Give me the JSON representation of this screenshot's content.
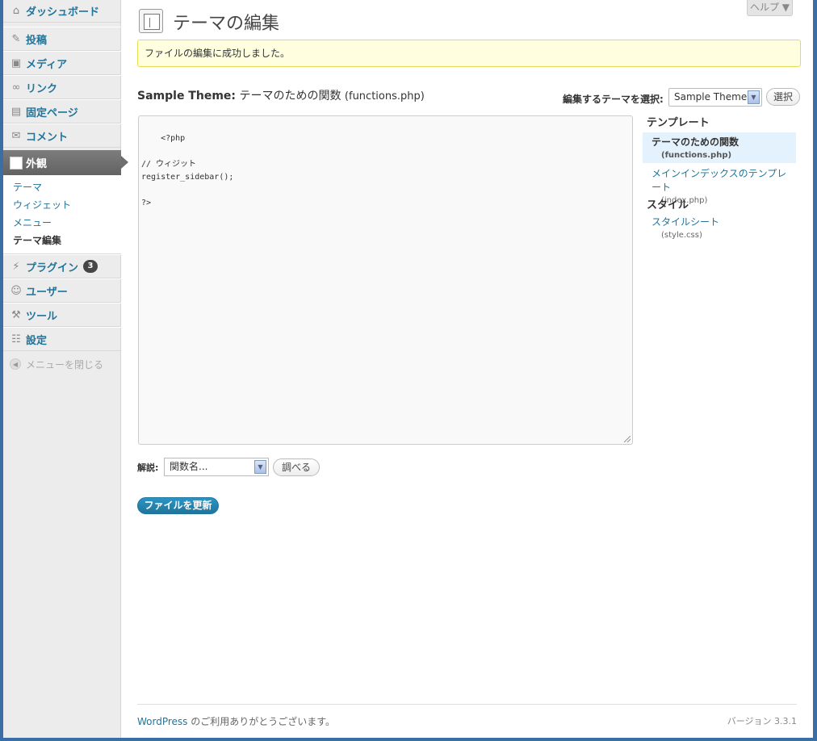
{
  "sidebar": {
    "items": [
      {
        "label": "ダッシュボード",
        "icon": "home-icon"
      },
      {
        "label": "投稿",
        "icon": "pin-icon"
      },
      {
        "label": "メディア",
        "icon": "media-icon"
      },
      {
        "label": "リンク",
        "icon": "link-icon"
      },
      {
        "label": "固定ページ",
        "icon": "page-icon"
      },
      {
        "label": "コメント",
        "icon": "comment-icon"
      }
    ],
    "active": {
      "label": "外観",
      "icon": "appearance-icon"
    },
    "submenu": [
      "テーマ",
      "ウィジェット",
      "メニュー",
      "テーマ編集"
    ],
    "items_after": [
      {
        "label": "プラグイン",
        "icon": "plugin-icon",
        "badge": "3"
      },
      {
        "label": "ユーザー",
        "icon": "users-icon"
      },
      {
        "label": "ツール",
        "icon": "tools-icon"
      },
      {
        "label": "設定",
        "icon": "settings-icon"
      }
    ],
    "collapse_label": "メニューを閉じる"
  },
  "header": {
    "title": "テーマの編集",
    "help_label": "ヘルプ ▼"
  },
  "notice": "ファイルの編集に成功しました。",
  "file_heading": {
    "theme_name": "Sample Theme:",
    "file_title": "テーマのための関数",
    "file_name": "(functions.php)"
  },
  "theme_selector": {
    "label": "編集するテーマを選択:",
    "selected": "Sample Theme",
    "button": "選択"
  },
  "editor": {
    "content": "<?php\n\n// ウィジット\nregister_sidebar();\n\n?>"
  },
  "templates": {
    "heading_templates": "テンプレート",
    "heading_styles": "スタイル",
    "files": [
      {
        "name": "テーマのための関数",
        "file": "(functions.php)",
        "current": true
      },
      {
        "name": "メインインデックスのテンプレート",
        "file": "(index.php)",
        "current": false
      }
    ],
    "styles": [
      {
        "name": "スタイルシート",
        "file": "(style.css)"
      }
    ]
  },
  "documentation": {
    "label": "解説:",
    "select_value": "関数名...",
    "button": "調べる"
  },
  "update_button": "ファイルを更新",
  "footer": {
    "link": "WordPress",
    "text": " のご利用ありがとうございます。",
    "version": "バージョン 3.3.1"
  }
}
